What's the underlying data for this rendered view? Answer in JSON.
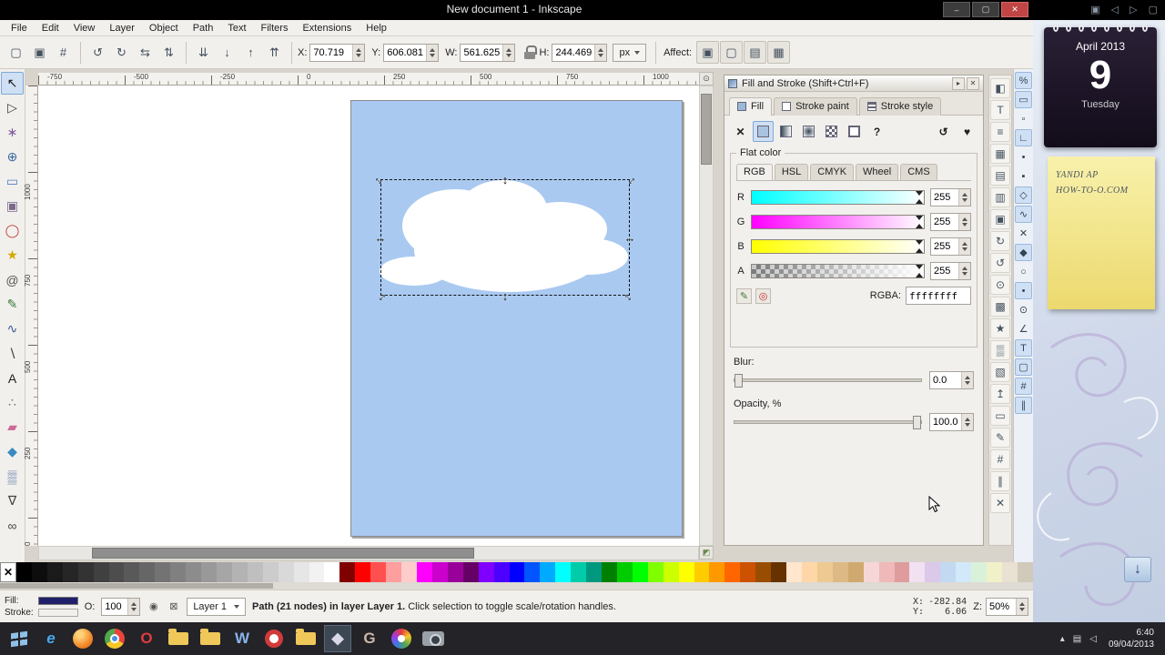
{
  "titlebar": {
    "title": "New document 1 - Inkscape",
    "window_buttons": [
      {
        "name": "minimize-button",
        "glyph": "–"
      },
      {
        "name": "maximize-button",
        "glyph": "▢"
      },
      {
        "name": "close-button",
        "glyph": "✕",
        "close": true
      }
    ],
    "overlay_icons": [
      {
        "name": "overlay-panel-icon",
        "glyph": "▣"
      },
      {
        "name": "overlay-prev-icon",
        "glyph": "◁"
      },
      {
        "name": "overlay-next-icon",
        "glyph": "▷"
      },
      {
        "name": "overlay-window-icon",
        "glyph": "▢"
      }
    ]
  },
  "menu": {
    "items": [
      "File",
      "Edit",
      "View",
      "Layer",
      "Object",
      "Path",
      "Text",
      "Filters",
      "Extensions",
      "Help"
    ]
  },
  "command_bar": {
    "left_icons": [
      {
        "name": "document-icon",
        "glyph": "▢"
      },
      {
        "name": "pages-icon",
        "glyph": "▣"
      },
      {
        "name": "grid-icon",
        "glyph": "#"
      }
    ],
    "transform_icons": [
      {
        "name": "rotate-ccw-icon",
        "glyph": "↺"
      },
      {
        "name": "rotate-cw-icon",
        "glyph": "↻"
      },
      {
        "name": "flip-horizontal-icon",
        "glyph": "⇆"
      },
      {
        "name": "flip-vertical-icon",
        "glyph": "⇅"
      }
    ],
    "zorder_icons": [
      {
        "name": "lower-to-bottom-icon",
        "glyph": "⇊"
      },
      {
        "name": "lower-icon",
        "glyph": "↓"
      },
      {
        "name": "raise-icon",
        "glyph": "↑"
      },
      {
        "name": "raise-to-top-icon",
        "glyph": "⇈"
      }
    ],
    "fields": [
      {
        "label": "X:",
        "value": "70.719"
      },
      {
        "label": "Y:",
        "value": "606.081"
      },
      {
        "label": "W:",
        "value": "561.625"
      },
      {
        "label": "H:",
        "value": "244.469"
      }
    ],
    "units": "px",
    "affect_label": "Affect:",
    "affect_buttons": [
      {
        "name": "affect-stroke-toggle",
        "glyph": "▣"
      },
      {
        "name": "affect-corners-toggle",
        "glyph": "▢"
      },
      {
        "name": "affect-gradients-toggle",
        "glyph": "▤"
      },
      {
        "name": "affect-patterns-toggle",
        "glyph": "▦"
      }
    ]
  },
  "toolbox": [
    {
      "name": "selector-tool",
      "glyph": "↖",
      "color": "#1a1a1a",
      "active": true
    },
    {
      "name": "node-tool",
      "glyph": "▷",
      "color": "#3a3a3a"
    },
    {
      "name": "tweak-tool",
      "glyph": "∗",
      "color": "#7a5a9a"
    },
    {
      "name": "zoom-tool",
      "glyph": "⊕",
      "color": "#3a6aa0"
    },
    {
      "name": "rectangle-tool",
      "glyph": "▭",
      "color": "#4a7fc1"
    },
    {
      "name": "box3d-tool",
      "glyph": "▣",
      "color": "#7a6a8a"
    },
    {
      "name": "ellipse-tool",
      "glyph": "◯",
      "color": "#c04040"
    },
    {
      "name": "star-tool",
      "glyph": "★",
      "color": "#d4a900"
    },
    {
      "name": "spiral-tool",
      "glyph": "@",
      "color": "#555555"
    },
    {
      "name": "pencil-tool",
      "glyph": "✎",
      "color": "#3a7a3a"
    },
    {
      "name": "bezier-tool",
      "glyph": "∿",
      "color": "#3a5a9a"
    },
    {
      "name": "calligraphy-tool",
      "glyph": "∖",
      "color": "#333333"
    },
    {
      "name": "text-tool",
      "glyph": "A",
      "color": "#222222"
    },
    {
      "name": "spray-tool",
      "glyph": "∴",
      "color": "#666666"
    },
    {
      "name": "eraser-tool",
      "glyph": "▰",
      "color": "#d06a9a"
    },
    {
      "name": "bucket-tool",
      "glyph": "◆",
      "color": "#3a8ac0"
    },
    {
      "name": "gradient-tool",
      "glyph": "▒",
      "color": "#4a6a9a"
    },
    {
      "name": "dropper-tool",
      "glyph": "∇",
      "color": "#444444"
    },
    {
      "name": "connector-tool",
      "glyph": "∞",
      "color": "#444444"
    }
  ],
  "rulers": {
    "top_labels": [
      "-750",
      "-500",
      "-250",
      "0",
      "250",
      "500",
      "750",
      "1000"
    ],
    "left_labels": [
      "1000",
      "750",
      "500",
      "250",
      "0"
    ]
  },
  "canvas": {
    "page_color": "#a9c9f1",
    "handle_glyphs": {
      "h": "↔",
      "v": "↕"
    },
    "zoom_lock_glyph": "⊙",
    "cms_toggle_glyph": "◩"
  },
  "fill_stroke": {
    "title": "Fill and Stroke (Shift+Ctrl+F)",
    "title_buttons": [
      {
        "name": "dock-panel-button",
        "glyph": "▸"
      },
      {
        "name": "close-panel-button",
        "glyph": "✕"
      }
    ],
    "tabs": [
      {
        "label": "Fill",
        "active": true
      },
      {
        "label": "Stroke paint"
      },
      {
        "label": "Stroke style"
      }
    ],
    "paint_buttons": [
      {
        "name": "paint-none-button",
        "style": "x",
        "glyph": "✕"
      },
      {
        "name": "paint-flat-button",
        "style": "flat",
        "active": true
      },
      {
        "name": "paint-linear-gradient-button",
        "style": "linear"
      },
      {
        "name": "paint-radial-gradient-button",
        "style": "radial"
      },
      {
        "name": "paint-pattern-button",
        "style": "pattern"
      },
      {
        "name": "paint-swatch-button",
        "style": "swatch"
      },
      {
        "name": "paint-unknown-button",
        "style": "unknown",
        "glyph": "?"
      }
    ],
    "fill_rule_buttons": [
      {
        "name": "fill-rule-evenodd-button",
        "glyph": "↺"
      },
      {
        "name": "fill-rule-nonzero-button",
        "glyph": "♥"
      }
    ],
    "flat_color_label": "Flat color",
    "color_tabs": [
      {
        "label": "RGB",
        "active": true
      },
      {
        "label": "HSL"
      },
      {
        "label": "CMYK"
      },
      {
        "label": "Wheel"
      },
      {
        "label": "CMS"
      }
    ],
    "channels": [
      {
        "label": "R",
        "value": "255",
        "from": "#00ffff"
      },
      {
        "label": "G",
        "value": "255",
        "from": "#ff00ff"
      },
      {
        "label": "B",
        "value": "255",
        "from": "#ffff00"
      },
      {
        "label": "A",
        "value": "255",
        "checker": true
      }
    ],
    "picker_icons": [
      {
        "name": "color-picker-icon",
        "glyph": "✎",
        "color": "#3a7a3a"
      },
      {
        "name": "color-average-icon",
        "glyph": "◎",
        "color": "#c03030"
      }
    ],
    "rgba_label": "RGBA:",
    "rgba_value": "ffffffff",
    "blur_label": "Blur:",
    "blur_value": "0.0",
    "opacity_label": "Opacity, %",
    "opacity_value": "100.0"
  },
  "dialog_bar": [
    {
      "name": "fill-stroke-dialog-icon",
      "glyph": "◧"
    },
    {
      "name": "text-font-dialog-icon",
      "glyph": "T"
    },
    {
      "name": "xml-editor-dialog-icon",
      "glyph": "≡"
    },
    {
      "name": "align-dialog-icon",
      "glyph": "▦"
    },
    {
      "name": "document-properties-dialog-icon",
      "glyph": "▤"
    },
    {
      "name": "layers-dialog-icon",
      "glyph": "▥"
    },
    {
      "name": "object-properties-dialog-icon",
      "glyph": "▣"
    },
    {
      "name": "transform-dialog-icon",
      "glyph": "↻"
    },
    {
      "name": "undo-history-dialog-icon",
      "glyph": "↺"
    },
    {
      "name": "find-dialog-icon",
      "glyph": "⊙"
    },
    {
      "name": "clone-dialog-icon",
      "glyph": "▩"
    },
    {
      "name": "symbols-dialog-icon",
      "glyph": "★"
    },
    {
      "name": "gradient-dialog-icon",
      "glyph": "▒"
    },
    {
      "name": "trace-bitmap-dialog-icon",
      "glyph": "▧"
    },
    {
      "name": "export-dialog-icon",
      "glyph": "↥"
    },
    {
      "name": "messages-dialog-icon",
      "glyph": "▭"
    },
    {
      "name": "input-devices-dialog-icon",
      "glyph": "✎"
    },
    {
      "name": "grid-dialog-icon",
      "glyph": "#"
    },
    {
      "name": "guides-dialog-icon",
      "glyph": "∥"
    },
    {
      "name": "close-dialogs-icon",
      "glyph": "✕"
    }
  ],
  "snap_bar": [
    {
      "name": "snap-enable-icon",
      "glyph": "%",
      "active": true
    },
    {
      "name": "snap-bbox-icon",
      "glyph": "▭",
      "active": true
    },
    {
      "name": "snap-bbox-edge-icon",
      "glyph": "▫"
    },
    {
      "name": "snap-bbox-corner-icon",
      "glyph": "∟",
      "active": true
    },
    {
      "name": "snap-bbox-edge-midpoint-icon",
      "glyph": "•"
    },
    {
      "name": "snap-bbox-center-icon",
      "glyph": "▪"
    },
    {
      "name": "snap-nodes-icon",
      "glyph": "◇",
      "active": true
    },
    {
      "name": "snap-path-icon",
      "glyph": "∿",
      "active": true
    },
    {
      "name": "snap-path-intersection-icon",
      "glyph": "✕"
    },
    {
      "name": "snap-cusp-node-icon",
      "glyph": "◆",
      "active": true
    },
    {
      "name": "snap-smooth-node-icon",
      "glyph": "○"
    },
    {
      "name": "snap-line-midpoint-icon",
      "glyph": "•",
      "active": true
    },
    {
      "name": "snap-object-center-icon",
      "glyph": "⊙"
    },
    {
      "name": "snap-rotation-center-icon",
      "glyph": "∠"
    },
    {
      "name": "snap-text-baseline-icon",
      "glyph": "T",
      "active": true
    },
    {
      "name": "snap-page-border-icon",
      "glyph": "▢",
      "active": true
    },
    {
      "name": "snap-grid-icon",
      "glyph": "#",
      "active": true
    },
    {
      "name": "snap-guide-icon",
      "glyph": "∥",
      "active": true
    }
  ],
  "palette": {
    "none_glyph": "✕",
    "colors": [
      "#000000",
      "#0d0d0d",
      "#1a1a1a",
      "#262626",
      "#333333",
      "#404040",
      "#4d4d4d",
      "#595959",
      "#666666",
      "#737373",
      "#808080",
      "#8c8c8c",
      "#999999",
      "#a6a6a6",
      "#b3b3b3",
      "#bfbfbf",
      "#cccccc",
      "#d9d9d9",
      "#e6e6e6",
      "#f2f2f2",
      "#ffffff",
      "#800000",
      "#ff0000",
      "#ff5050",
      "#ff9e9e",
      "#ffcccc",
      "#ff00ff",
      "#cc00cc",
      "#990099",
      "#660066",
      "#7f00ff",
      "#4c00ff",
      "#0000ff",
      "#0055ff",
      "#00aaff",
      "#00ffff",
      "#00ccaa",
      "#009980",
      "#008000",
      "#00cc00",
      "#00ff00",
      "#7fff00",
      "#ccff00",
      "#ffff00",
      "#ffcc00",
      "#ff9900",
      "#ff6600",
      "#cc5200",
      "#994d00",
      "#663300",
      "#ffe6cc",
      "#ffd6a8",
      "#eec992",
      "#ddba85",
      "#cfa96f",
      "#f6d6d6",
      "#efb9b9",
      "#df9c9c",
      "#f1e1f1",
      "#dac9e9",
      "#c2d9f1",
      "#d2e9f9",
      "#d9f1d9",
      "#f1f1c9",
      "#e9e1d1",
      "#d1c9b9"
    ]
  },
  "status_bar": {
    "fill_label": "Fill:",
    "fill_color": "#20206a",
    "stroke_label": "Stroke:",
    "opacity_label": "O:",
    "opacity_value": "100",
    "visibility_icon_glyph": "◉",
    "lock_icon_glyph": "⊠",
    "layer_value": "Layer 1",
    "message_bold": "Path (21 nodes) in layer Layer 1.",
    "message_rest": " Click selection to toggle scale/rotation handles.",
    "x_label": "X:",
    "x_value": "-282.84",
    "y_label": "Y:",
    "y_value": "6.06",
    "z_label": "Z:",
    "z_value": "50%"
  },
  "desktop": {
    "calendar": {
      "month": "April 2013",
      "day": "9",
      "weekday": "Tuesday"
    },
    "note_lines": [
      "YANDI AP",
      "HOW-TO-O.COM"
    ],
    "download_icon_glyph": "↓"
  },
  "taskbar": {
    "icons": [
      {
        "name": "start-button",
        "type": "winlogo"
      },
      {
        "name": "internet-explorer-icon",
        "type": "letter",
        "glyph": "e",
        "color": "#49a8ea",
        "italic": true
      },
      {
        "name": "firefox-icon",
        "type": "firefox"
      },
      {
        "name": "chrome-icon",
        "type": "chrome"
      },
      {
        "name": "opera-icon",
        "type": "letter",
        "glyph": "O",
        "color": "#e23b3b",
        "bold": true
      },
      {
        "name": "folder-libraries-icon",
        "type": "folder"
      },
      {
        "name": "folder-documents-icon",
        "type": "folder"
      },
      {
        "name": "word-icon",
        "type": "letter",
        "glyph": "W",
        "color": "#8ab4ea",
        "bold": true
      },
      {
        "name": "media-record-icon",
        "type": "record"
      },
      {
        "name": "folder-projects-icon",
        "type": "folder"
      },
      {
        "name": "inkscape-icon",
        "type": "letter",
        "glyph": "◆",
        "color": "#d8d8e8",
        "active": true
      },
      {
        "name": "gimp-icon",
        "type": "letter",
        "glyph": "G",
        "color": "#cbb9a6",
        "bold": true
      },
      {
        "name": "color-palette-icon",
        "type": "palette"
      },
      {
        "name": "camera-icon",
        "type": "camera"
      }
    ],
    "tray_icons": [
      {
        "name": "tray-expand-icon",
        "glyph": "▴"
      },
      {
        "name": "tray-status-icon",
        "glyph": "▤"
      },
      {
        "name": "tray-volume-icon",
        "glyph": "◁"
      }
    ],
    "time": "6:40",
    "date": "09/04/2013"
  }
}
